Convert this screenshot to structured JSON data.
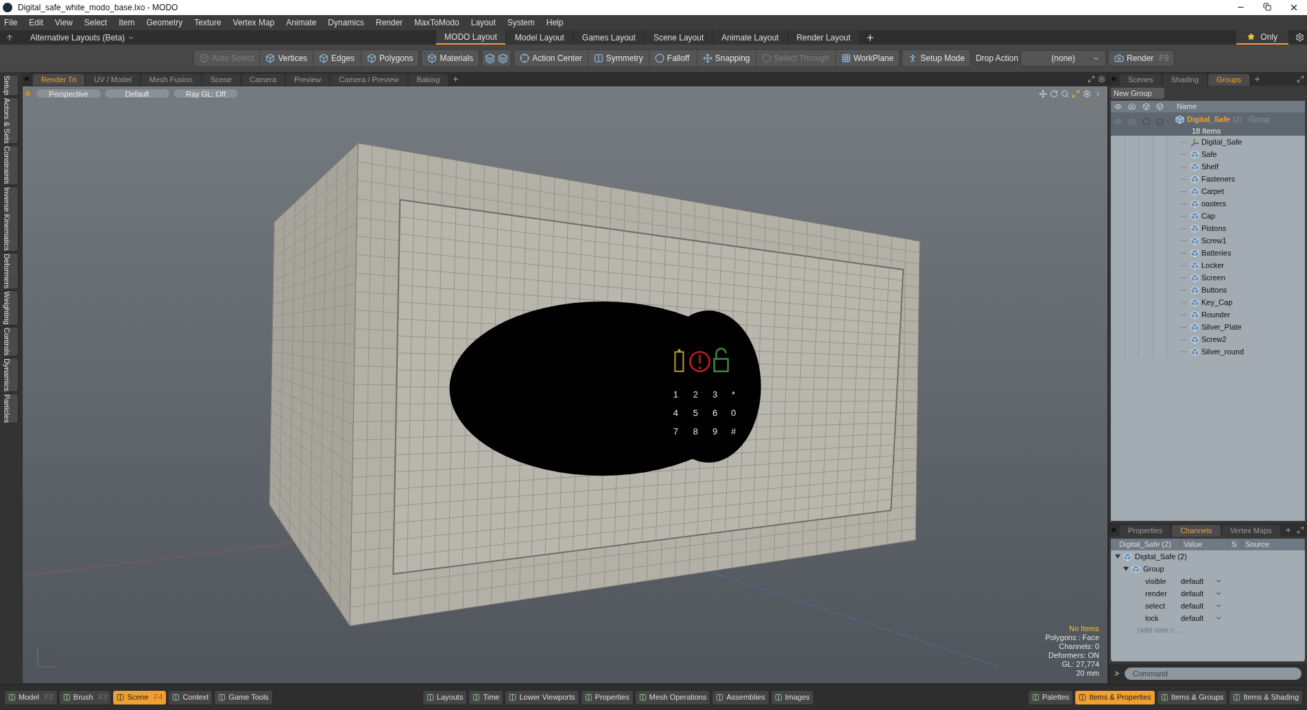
{
  "window": {
    "title": "Digital_safe_white_modo_base.lxo - MODO"
  },
  "menu": [
    "File",
    "Edit",
    "View",
    "Select",
    "Item",
    "Geometry",
    "Texture",
    "Vertex Map",
    "Animate",
    "Dynamics",
    "Render",
    "MaxToModo",
    "Layout",
    "System",
    "Help"
  ],
  "layout_bar": {
    "menu": "Alternative Layouts (Beta)",
    "tabs": [
      {
        "label": "MODO Layout",
        "selected": true
      },
      {
        "label": "Model Layout",
        "selected": false
      },
      {
        "label": "Games Layout",
        "selected": false
      },
      {
        "label": "Scene Layout",
        "selected": false
      },
      {
        "label": "Animate Layout",
        "selected": false
      },
      {
        "label": "Render Layout",
        "selected": false
      }
    ],
    "only": {
      "label": "Only",
      "selected": true
    }
  },
  "toolbar": {
    "groups": [
      {
        "items": [
          {
            "label": "Auto Select",
            "disabled": true
          },
          {
            "label": "Vertices",
            "disabled": false
          },
          {
            "label": "Edges",
            "disabled": false
          },
          {
            "label": "Polygons",
            "disabled": false
          }
        ]
      },
      {
        "items": [
          {
            "label": "Materials",
            "disabled": false
          }
        ]
      },
      {
        "items": [
          {
            "label": "Action Center",
            "disabled": false
          },
          {
            "label": "Symmetry",
            "disabled": false
          },
          {
            "label": "Falloff",
            "disabled": false
          },
          {
            "label": "Snapping",
            "disabled": false
          },
          {
            "label": "Select Through",
            "disabled": true
          },
          {
            "label": "WorkPlane",
            "disabled": false
          }
        ]
      },
      {
        "items": [
          {
            "label": "Setup Mode",
            "disabled": false
          }
        ]
      }
    ],
    "drop_action": {
      "label": "Drop Action",
      "value": "(none)"
    },
    "render": {
      "label": "Render",
      "shortcut": "F9"
    }
  },
  "left_tabs": [
    "Setup",
    "Actors & Sets",
    "Constraints",
    "Inverse Kinematics",
    "Deformers",
    "Weighting",
    "Controls",
    "Dynamics",
    "Particles"
  ],
  "viewport_tabs": [
    {
      "label": "Render Tri",
      "selected": true
    },
    {
      "label": "UV / Model",
      "selected": false
    },
    {
      "label": "Mesh Fusion",
      "selected": false
    },
    {
      "label": "Scene",
      "selected": false
    },
    {
      "label": "Camera",
      "selected": false
    },
    {
      "label": "Preview",
      "selected": false
    },
    {
      "label": "Camera / Preview",
      "selected": false
    },
    {
      "label": "Baking",
      "selected": false
    }
  ],
  "viewport": {
    "view_buttons": [
      "Perspective",
      "Default",
      "Ray GL: Off"
    ],
    "keypad": [
      "1",
      "2",
      "3",
      "*",
      "4",
      "5",
      "6",
      "0",
      "7",
      "8",
      "9",
      "#"
    ],
    "info": {
      "selection": "No Items",
      "lines": [
        "Polygons : Face",
        "Channels: 0",
        "Deformers: ON",
        "GL: 27,774",
        "20 mm"
      ]
    }
  },
  "groups_panel": {
    "tabs": [
      {
        "label": "Scenes",
        "selected": false
      },
      {
        "label": "Shading",
        "selected": false
      },
      {
        "label": "Groups",
        "selected": true
      }
    ],
    "new_group": "New Group",
    "column": "Name",
    "group": {
      "name": "Digital_Safe",
      "count": "(2)",
      "type": ": Group",
      "items_count": "18 Items",
      "children": [
        {
          "name": "Digital_Safe",
          "kind": "locator"
        },
        {
          "name": "Safe",
          "kind": "mesh"
        },
        {
          "name": "Shelf",
          "kind": "mesh"
        },
        {
          "name": "Fasteners",
          "kind": "mesh"
        },
        {
          "name": "Carpet",
          "kind": "mesh"
        },
        {
          "name": "oasters",
          "kind": "mesh"
        },
        {
          "name": "Cap",
          "kind": "mesh"
        },
        {
          "name": "Pistons",
          "kind": "mesh"
        },
        {
          "name": "Screw1",
          "kind": "mesh"
        },
        {
          "name": "Batteries",
          "kind": "mesh"
        },
        {
          "name": "Locker",
          "kind": "mesh"
        },
        {
          "name": "Screen",
          "kind": "mesh"
        },
        {
          "name": "Buttons",
          "kind": "mesh"
        },
        {
          "name": "Key_Cap",
          "kind": "mesh"
        },
        {
          "name": "Rounder",
          "kind": "mesh"
        },
        {
          "name": "Silver_Plate",
          "kind": "mesh"
        },
        {
          "name": "Screw2",
          "kind": "mesh"
        },
        {
          "name": "Silver_round",
          "kind": "mesh"
        }
      ]
    }
  },
  "channels_panel": {
    "tabs": [
      {
        "label": "Properties",
        "selected": false
      },
      {
        "label": "Channels",
        "selected": true
      },
      {
        "label": "Vertex Maps",
        "selected": false
      }
    ],
    "columns": [
      "Digital_Safe (2)",
      "Value",
      "S",
      "Source"
    ],
    "tree": {
      "name": "Digital_Safe (2)",
      "expanded": true,
      "children": [
        {
          "name": "Group",
          "expanded": true,
          "channels": [
            {
              "name": "visible",
              "value": "default"
            },
            {
              "name": "render",
              "value": "default"
            },
            {
              "name": "select",
              "value": "default"
            },
            {
              "name": "lock",
              "value": "default"
            }
          ],
          "add_user": "(add user c…"
        }
      ]
    }
  },
  "command": {
    "prompt": ">",
    "placeholder": "Command"
  },
  "bottom_bar": {
    "left": [
      {
        "label": "Model",
        "shortcut": "F2",
        "selected": false
      },
      {
        "label": "Brush",
        "shortcut": "F3",
        "selected": false
      },
      {
        "label": "Scene",
        "shortcut": "F4",
        "selected": true
      },
      {
        "label": "Context",
        "selected": false
      },
      {
        "label": "Game Tools",
        "selected": false
      }
    ],
    "center": [
      {
        "label": "Layouts",
        "selected": false
      },
      {
        "label": "Time",
        "selected": false
      },
      {
        "label": "Lower Viewports",
        "selected": false
      },
      {
        "label": "Properties",
        "selected": false
      },
      {
        "label": "Mesh Operations",
        "selected": false
      },
      {
        "label": "Assemblies",
        "selected": false
      },
      {
        "label": "Images",
        "selected": false
      }
    ],
    "right": [
      {
        "label": "Palettes",
        "selected": false
      },
      {
        "label": "Items & Properties",
        "selected": true
      },
      {
        "label": "Items & Groups",
        "selected": false
      },
      {
        "label": "Items & Shading",
        "selected": false
      }
    ]
  }
}
